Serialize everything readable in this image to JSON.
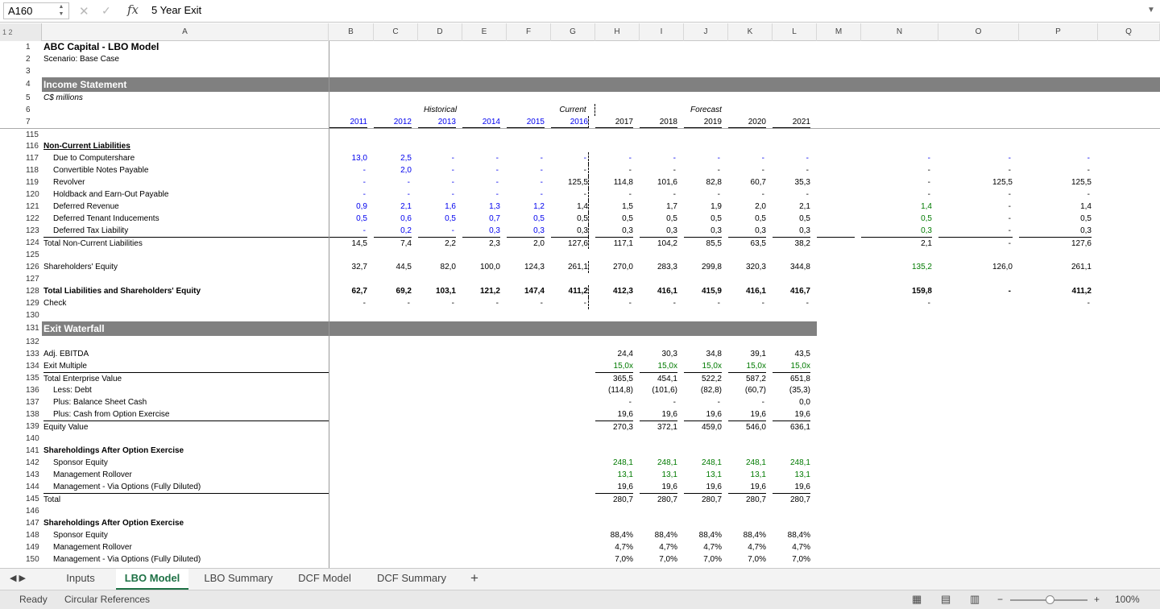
{
  "formula_bar": {
    "cell_ref": "A160",
    "fx": "fx",
    "value": "5 Year Exit"
  },
  "outline_levels": "1 2",
  "columns": [
    "A",
    "B",
    "C",
    "D",
    "E",
    "F",
    "G",
    "H",
    "I",
    "J",
    "K",
    "L",
    "M",
    "N",
    "O",
    "P",
    "Q"
  ],
  "sheet": {
    "title": "ABC Capital - LBO Model",
    "scenario": "Scenario: Base Case",
    "income_header": "Income Statement",
    "units": "C$ millions",
    "period_labels": {
      "historical": "Historical",
      "current": "Current",
      "forecast": "Forecast"
    },
    "years": [
      "2011",
      "2012",
      "2013",
      "2014",
      "2015",
      "2016",
      "2017",
      "2018",
      "2019",
      "2020",
      "2021"
    ],
    "exit_header": "Exit Waterfall"
  },
  "row_numbers": [
    "1",
    "2",
    "3",
    "4",
    "5",
    "6",
    "7",
    "115",
    "116",
    "117",
    "118",
    "119",
    "120",
    "121",
    "122",
    "123",
    "124",
    "125",
    "126",
    "127",
    "128",
    "129",
    "130",
    "131",
    "132",
    "133",
    "134",
    "135",
    "136",
    "137",
    "138",
    "139",
    "140",
    "141",
    "142",
    "143",
    "144",
    "145",
    "146",
    "147",
    "148",
    "149",
    "150"
  ],
  "rows": [
    {
      "num": "116",
      "label": "Non-Current Liabilities",
      "style": "bold ul",
      "values": []
    },
    {
      "num": "117",
      "label": "Due to Computershare",
      "indent": true,
      "values": [
        "13,0",
        "2,5",
        "-",
        "-",
        "-",
        "-",
        "-",
        "-",
        "-",
        "-",
        "-",
        "",
        "-",
        "-",
        "-"
      ],
      "color": "blue"
    },
    {
      "num": "118",
      "label": "Convertible Notes Payable",
      "indent": true,
      "values": [
        "-",
        "2,0",
        "-",
        "-",
        "-",
        "-",
        "-",
        "-",
        "-",
        "-",
        "-",
        "",
        "-",
        "-",
        "-"
      ]
    },
    {
      "num": "119",
      "label": "Revolver",
      "indent": true,
      "values": [
        "-",
        "-",
        "-",
        "-",
        "-",
        "125,5",
        "114,8",
        "101,6",
        "82,8",
        "60,7",
        "35,3",
        "",
        "-",
        "125,5",
        "125,5"
      ]
    },
    {
      "num": "120",
      "label": "Holdback and Earn-Out Payable",
      "indent": true,
      "values": [
        "-",
        "-",
        "-",
        "-",
        "-",
        "-",
        "-",
        "-",
        "-",
        "-",
        "-",
        "",
        "-",
        "-",
        "-"
      ]
    },
    {
      "num": "121",
      "label": "Deferred Revenue",
      "indent": true,
      "values": [
        "0,9",
        "2,1",
        "1,6",
        "1,3",
        "1,2",
        "1,4",
        "1,5",
        "1,7",
        "1,9",
        "2,0",
        "2,1",
        "",
        "1,4",
        "-",
        "1,4"
      ]
    },
    {
      "num": "122",
      "label": "Deferred Tenant Inducements",
      "indent": true,
      "values": [
        "0,5",
        "0,6",
        "0,5",
        "0,7",
        "0,5",
        "0,5",
        "0,5",
        "0,5",
        "0,5",
        "0,5",
        "0,5",
        "",
        "0,5",
        "-",
        "0,5"
      ]
    },
    {
      "num": "123",
      "label": "Deferred Tax Liability",
      "indent": true,
      "values": [
        "-",
        "0,2",
        "-",
        "0,3",
        "0,3",
        "0,3",
        "0,3",
        "0,3",
        "0,3",
        "0,3",
        "0,3",
        "",
        "0,3",
        "-",
        "0,3"
      ]
    },
    {
      "num": "124",
      "label": "Total Non-Current Liabilities",
      "total": true,
      "values": [
        "14,5",
        "7,4",
        "2,2",
        "2,3",
        "2,0",
        "127,6",
        "117,1",
        "104,2",
        "85,5",
        "63,5",
        "38,2",
        "",
        "2,1",
        "-",
        "127,6"
      ]
    },
    {
      "num": "125",
      "label": "",
      "values": []
    },
    {
      "num": "126",
      "label": "Shareholders' Equity",
      "values": [
        "32,7",
        "44,5",
        "82,0",
        "100,0",
        "124,3",
        "261,1",
        "270,0",
        "283,3",
        "299,8",
        "320,3",
        "344,8",
        "",
        "135,2",
        "126,0",
        "261,1"
      ]
    },
    {
      "num": "127",
      "label": "",
      "values": []
    },
    {
      "num": "128",
      "label": "Total Liabilities and Shareholders' Equity",
      "style": "bold",
      "values": [
        "62,7",
        "69,2",
        "103,1",
        "121,2",
        "147,4",
        "411,2",
        "412,3",
        "416,1",
        "415,9",
        "416,1",
        "416,7",
        "",
        "159,8",
        "-",
        "411,2"
      ]
    },
    {
      "num": "129",
      "label": "Check",
      "values": [
        "-",
        "-",
        "-",
        "-",
        "-",
        "-",
        "-",
        "-",
        "-",
        "-",
        "-",
        "",
        "-",
        "",
        "-"
      ]
    },
    {
      "num": "130",
      "label": "",
      "values": []
    }
  ],
  "exit_rows": [
    {
      "num": "132",
      "label": "",
      "values": []
    },
    {
      "num": "133",
      "label": "Adj. EBITDA",
      "values": [
        "24,4",
        "30,3",
        "34,8",
        "39,1",
        "43,5"
      ]
    },
    {
      "num": "134",
      "label": "Exit Multiple",
      "values": [
        "15,0x",
        "15,0x",
        "15,0x",
        "15,0x",
        "15,0x"
      ],
      "color": "green"
    },
    {
      "num": "135",
      "label": "Total Enterprise Value",
      "values": [
        "365,5",
        "454,1",
        "522,2",
        "587,2",
        "651,8"
      ]
    },
    {
      "num": "136",
      "label": "Less: Debt",
      "indent": true,
      "values": [
        "(114,8)",
        "(101,6)",
        "(82,8)",
        "(60,7)",
        "(35,3)"
      ]
    },
    {
      "num": "137",
      "label": "Plus: Balance Sheet Cash",
      "indent": true,
      "values": [
        "-",
        "-",
        "-",
        "-",
        "0,0"
      ]
    },
    {
      "num": "138",
      "label": "Plus: Cash from Option Exercise",
      "indent": true,
      "values": [
        "19,6",
        "19,6",
        "19,6",
        "19,6",
        "19,6"
      ]
    },
    {
      "num": "139",
      "label": "Equity Value",
      "values": [
        "270,3",
        "372,1",
        "459,0",
        "546,0",
        "636,1"
      ]
    },
    {
      "num": "140",
      "label": "",
      "values": []
    },
    {
      "num": "141",
      "label": "Shareholdings After Option Exercise",
      "style": "bold",
      "values": []
    },
    {
      "num": "142",
      "label": "Sponsor Equity",
      "indent": true,
      "values": [
        "248,1",
        "248,1",
        "248,1",
        "248,1",
        "248,1"
      ],
      "color": "green"
    },
    {
      "num": "143",
      "label": "Management Rollover",
      "indent": true,
      "values": [
        "13,1",
        "13,1",
        "13,1",
        "13,1",
        "13,1"
      ],
      "color": "green"
    },
    {
      "num": "144",
      "label": "Management - Via Options (Fully Diluted)",
      "indent": true,
      "values": [
        "19,6",
        "19,6",
        "19,6",
        "19,6",
        "19,6"
      ]
    },
    {
      "num": "145",
      "label": "Total",
      "values": [
        "280,7",
        "280,7",
        "280,7",
        "280,7",
        "280,7"
      ]
    },
    {
      "num": "146",
      "label": "",
      "values": []
    },
    {
      "num": "147",
      "label": "Shareholdings After Option Exercise",
      "style": "bold",
      "values": []
    },
    {
      "num": "148",
      "label": "Sponsor Equity",
      "indent": true,
      "values": [
        "88,4%",
        "88,4%",
        "88,4%",
        "88,4%",
        "88,4%"
      ]
    },
    {
      "num": "149",
      "label": "Management Rollover",
      "indent": true,
      "values": [
        "4,7%",
        "4,7%",
        "4,7%",
        "4,7%",
        "4,7%"
      ]
    },
    {
      "num": "150",
      "label": "Management - Via Options (Fully Diluted)",
      "indent": true,
      "values": [
        "7,0%",
        "7,0%",
        "7,0%",
        "7,0%",
        "7,0%"
      ]
    }
  ],
  "tabs": [
    "Inputs",
    "LBO Model",
    "LBO Summary",
    "DCF Model",
    "DCF Summary"
  ],
  "active_tab": "LBO Model",
  "add_sheet": "+",
  "status": {
    "ready": "Ready",
    "circular": "Circular References",
    "zoom": "100%"
  }
}
